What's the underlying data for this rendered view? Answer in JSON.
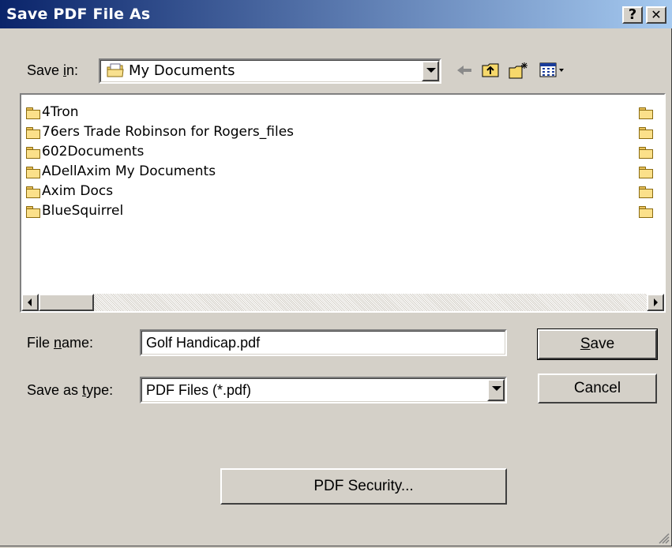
{
  "window": {
    "title": "Save PDF File As",
    "help_label": "?",
    "close_label": "✕"
  },
  "toolbar": {
    "save_in_label_pre": "Save ",
    "save_in_label_u": "i",
    "save_in_label_post": "n:",
    "location": "My Documents",
    "icons": [
      "back-icon",
      "up-folder-icon",
      "new-folder-icon",
      "view-menu-icon"
    ]
  },
  "files": [
    {
      "name": "4Tron"
    },
    {
      "name": "76ers Trade Robinson for Rogers_files"
    },
    {
      "name": "602Documents"
    },
    {
      "name": "ADellAxim My Documents"
    },
    {
      "name": "Axim Docs"
    },
    {
      "name": "BlueSquirrel"
    }
  ],
  "form": {
    "file_name_label_pre": "File ",
    "file_name_label_u": "n",
    "file_name_label_post": "ame:",
    "file_name_value": "Golf Handicap.pdf",
    "save_type_label_pre": "Save as ",
    "save_type_label_u": "t",
    "save_type_label_post": "ype:",
    "save_type_value": "PDF Files (*.pdf)"
  },
  "buttons": {
    "save_u": "S",
    "save_rest": "ave",
    "cancel": "Cancel",
    "pdf_security": "PDF Security..."
  }
}
